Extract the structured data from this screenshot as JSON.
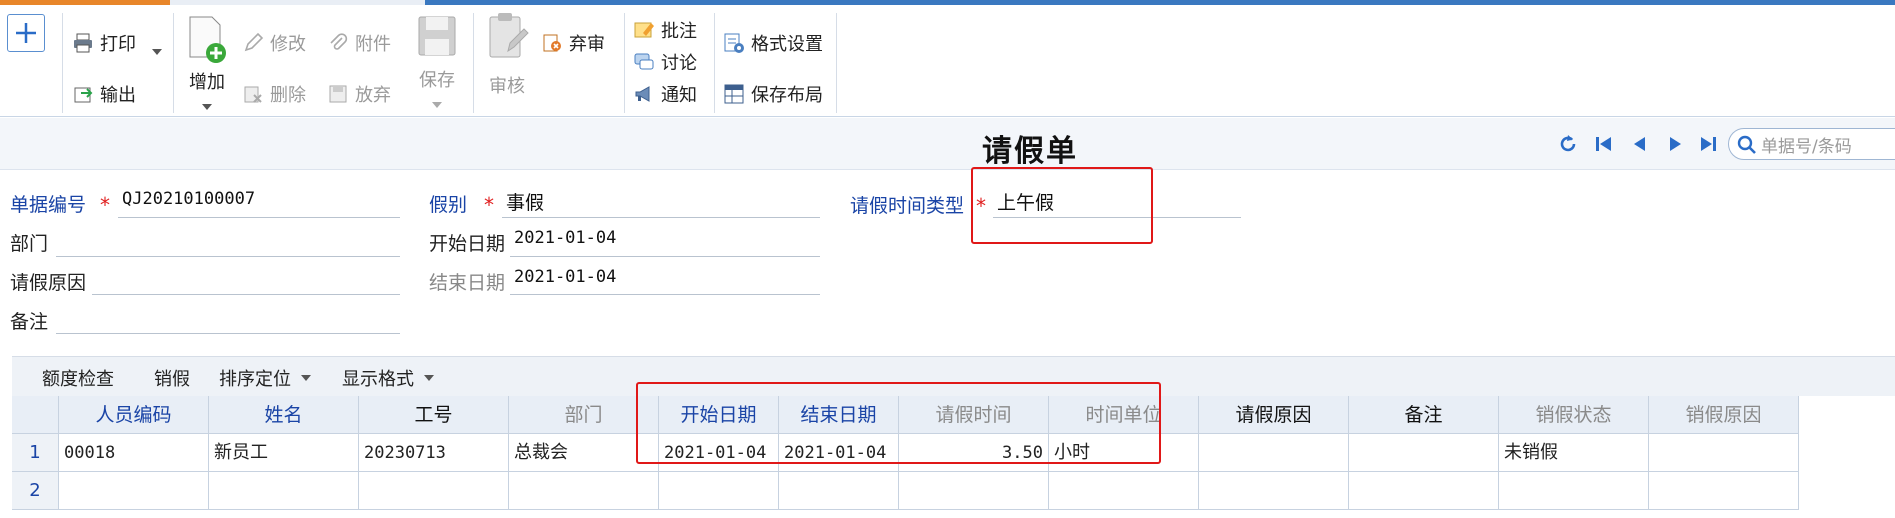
{
  "toolbar": {
    "add_label": "增加",
    "print_label": "打印",
    "export_label": "输出",
    "modify_label": "修改",
    "attach_label": "附件",
    "delete_label": "删除",
    "discard_label": "放弃",
    "save_label": "保存",
    "audit_label": "审核",
    "abandon_label": "弃审",
    "annotate_label": "批注",
    "discuss_label": "讨论",
    "notify_label": "通知",
    "format_settings_label": "格式设置",
    "save_layout_label": "保存布局"
  },
  "header": {
    "title": "请假单",
    "search_placeholder": "单据号/条码"
  },
  "form": {
    "doc_no_label": "单据编号",
    "doc_no_value": "QJ20210100007",
    "dept_label": "部门",
    "reason_label": "请假原因",
    "remark_label": "备注",
    "leave_type_label": "假别",
    "leave_type_value": "事假",
    "start_date_label": "开始日期",
    "start_date_value": "2021-01-04",
    "end_date_label": "结束日期",
    "end_date_value": "2021-01-04",
    "time_type_label": "请假时间类型",
    "time_type_value": "上午假"
  },
  "grid_toolbar": {
    "quota_check": "额度检查",
    "cancel_leave": "销假",
    "sort_locate": "排序定位",
    "display_format": "显示格式"
  },
  "grid": {
    "columns": [
      "人员编码",
      "姓名",
      "工号",
      "部门",
      "开始日期",
      "结束日期",
      "请假时间",
      "时间单位",
      "请假原因",
      "备注",
      "销假状态",
      "销假原因"
    ],
    "rows": [
      {
        "n": "1",
        "cells": [
          "00018",
          "新员工",
          "20230713",
          "总裁会",
          "2021-01-04",
          "2021-01-04",
          "3.50",
          "小时",
          "",
          "",
          "未销假",
          ""
        ]
      },
      {
        "n": "2",
        "cells": [
          "",
          "",
          "",
          "",
          "",
          "",
          "",
          "",
          "",
          "",
          "",
          ""
        ]
      }
    ]
  },
  "colors": {
    "accent_blue": "#3a78c0",
    "label_blue": "#1a44a6",
    "highlight_red": "#e01818",
    "required_red": "#e02020"
  }
}
